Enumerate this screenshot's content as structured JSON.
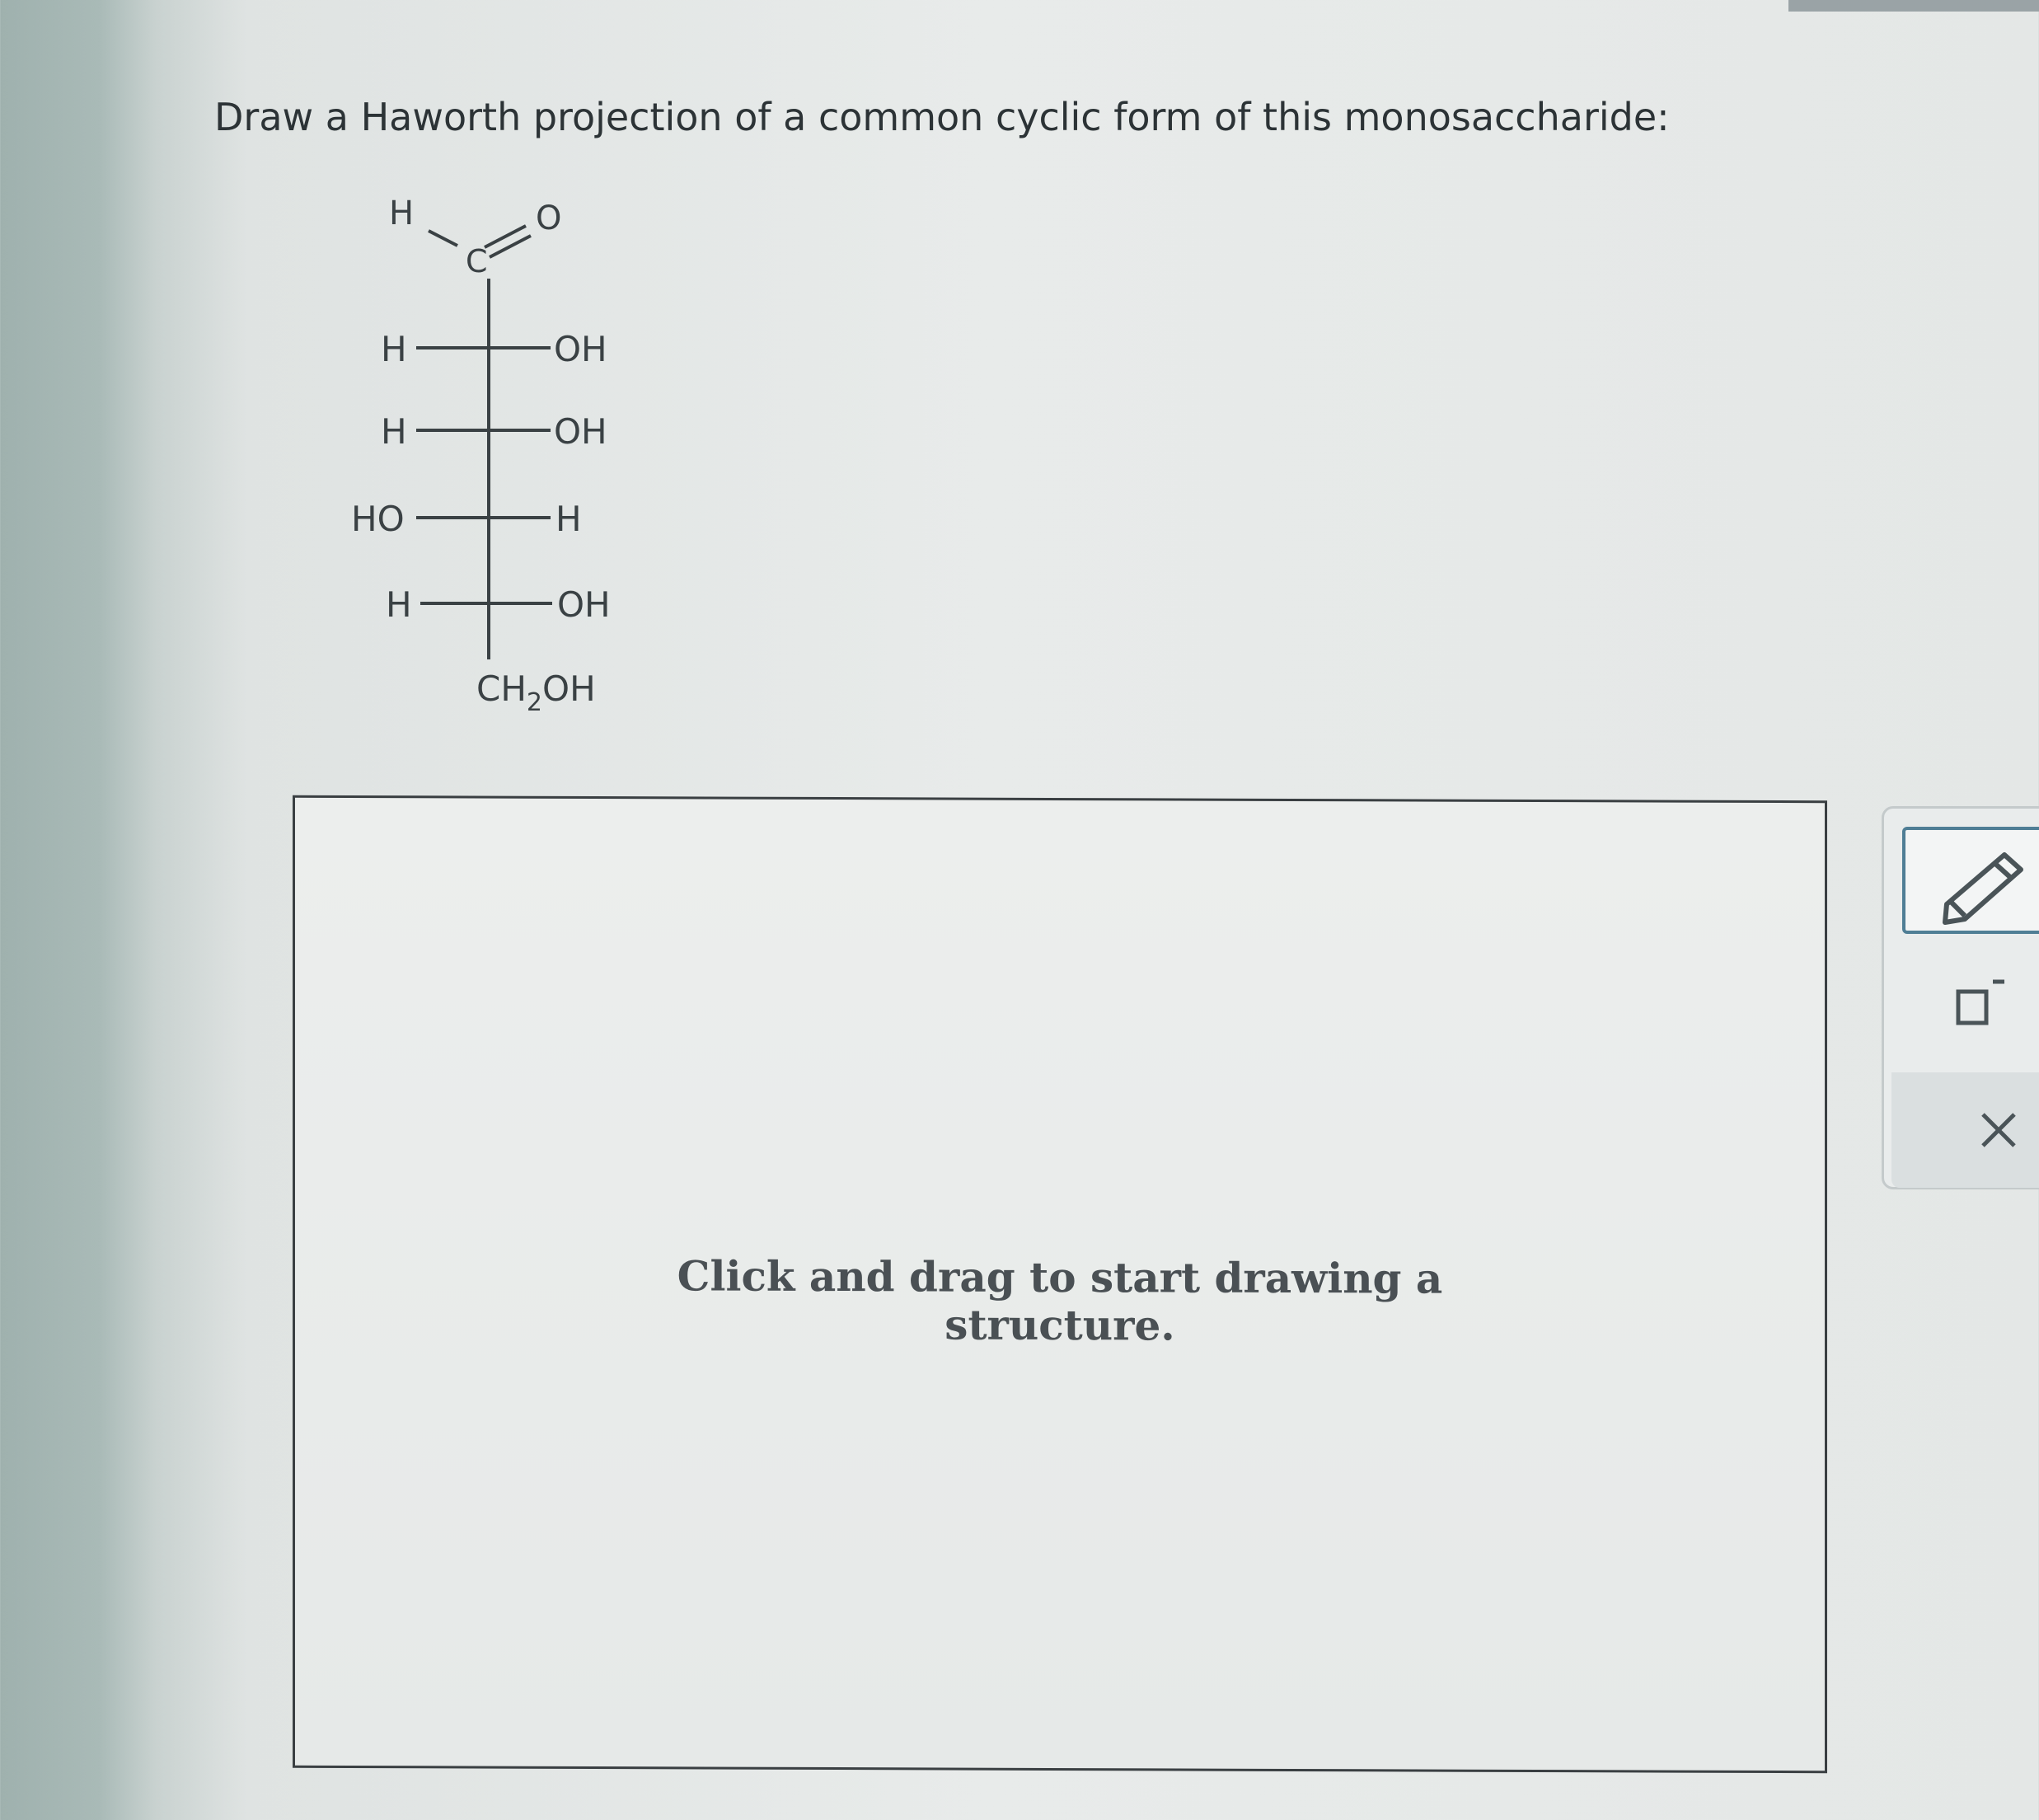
{
  "question": {
    "text": "Draw a Haworth projection of a common cyclic form of this monosaccharide:"
  },
  "structure": {
    "aldehyde_h": "H",
    "carbonyl_c": "C",
    "carbonyl_o": "O",
    "rows": [
      {
        "left": "H",
        "right": "OH"
      },
      {
        "left": "H",
        "right": "OH"
      },
      {
        "left": "HO",
        "right": "H"
      },
      {
        "left": "H",
        "right": "OH"
      }
    ],
    "bottom": {
      "ch": "CH",
      "sub": "2",
      "oh": "OH"
    }
  },
  "canvas": {
    "hint_line1": "Click and drag to start drawing a",
    "hint_line2": "structure."
  },
  "toolbar": {
    "icons": [
      "pencil-icon",
      "charge-box-icon",
      "close-icon"
    ]
  }
}
